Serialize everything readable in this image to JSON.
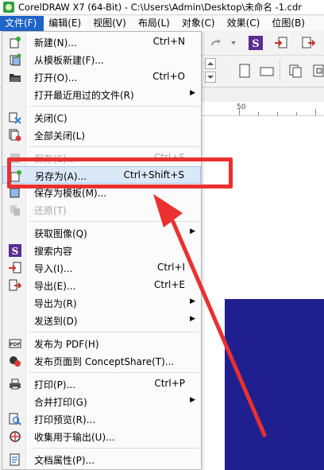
{
  "titlebar": {
    "title": "CorelDRAW X7 (64-Bit) - C:\\Users\\Admin\\Desktop\\未命名 -1.cdr"
  },
  "menubar": {
    "items": [
      "文件(F)",
      "编辑(E)",
      "视图(V)",
      "布局(L)",
      "对象(C)",
      "效果(C)",
      "位图(B)"
    ]
  },
  "ruler": {
    "mark": "50"
  },
  "file_menu": {
    "items": [
      {
        "label": "新建(N)...",
        "shortcut": "Ctrl+N",
        "icon": "new-doc-icon"
      },
      {
        "label": "从模板新建(F)...",
        "shortcut": "",
        "icon": "template-icon"
      },
      {
        "label": "打开(O)...",
        "shortcut": "Ctrl+O",
        "icon": "open-folder-icon"
      },
      {
        "label": "打开最近用过的文件(R)",
        "shortcut": "",
        "icon": ""
      },
      {
        "label": "关闭(C)",
        "shortcut": "",
        "icon": "close-doc-icon"
      },
      {
        "label": "全部关闭(L)",
        "shortcut": "",
        "icon": "close-all-icon"
      },
      {
        "label": "保存(S)...",
        "shortcut": "Ctrl+S",
        "icon": "save-icon"
      },
      {
        "label": "另存为(A)...",
        "shortcut": "Ctrl+Shift+S",
        "icon": "save-as-icon"
      },
      {
        "label": "保存为模板(M)...",
        "shortcut": "",
        "icon": "save-template-icon"
      },
      {
        "label": "还原(T)",
        "shortcut": "",
        "icon": "revert-icon"
      },
      {
        "label": "获取图像(Q)",
        "shortcut": "",
        "icon": ""
      },
      {
        "label": "搜索内容",
        "shortcut": "",
        "icon": "search-content-icon"
      },
      {
        "label": "导入(I)...",
        "shortcut": "Ctrl+I",
        "icon": "import-icon"
      },
      {
        "label": "导出(E)...",
        "shortcut": "Ctrl+E",
        "icon": "export-icon"
      },
      {
        "label": "导出为(R)",
        "shortcut": "",
        "icon": ""
      },
      {
        "label": "发送到(D)",
        "shortcut": "",
        "icon": ""
      },
      {
        "label": "发布为 PDF(H)",
        "shortcut": "",
        "icon": "pdf-icon"
      },
      {
        "label": "发布页面到 ConceptShare(T)...",
        "shortcut": "",
        "icon": "conceptshare-icon"
      },
      {
        "label": "打印(P)...",
        "shortcut": "Ctrl+P",
        "icon": "print-icon"
      },
      {
        "label": "合并打印(G)",
        "shortcut": "",
        "icon": ""
      },
      {
        "label": "打印预览(R)...",
        "shortcut": "",
        "icon": "print-preview-icon"
      },
      {
        "label": "收集用于输出(U)...",
        "shortcut": "",
        "icon": "collect-output-icon"
      },
      {
        "label": "文档属性(P)...",
        "shortcut": "",
        "icon": "document-properties-icon"
      }
    ]
  },
  "colors": {
    "menu_active": "#1e63c8",
    "annotation": "#ea3030",
    "canvas_rect": "#1f1f8f"
  }
}
